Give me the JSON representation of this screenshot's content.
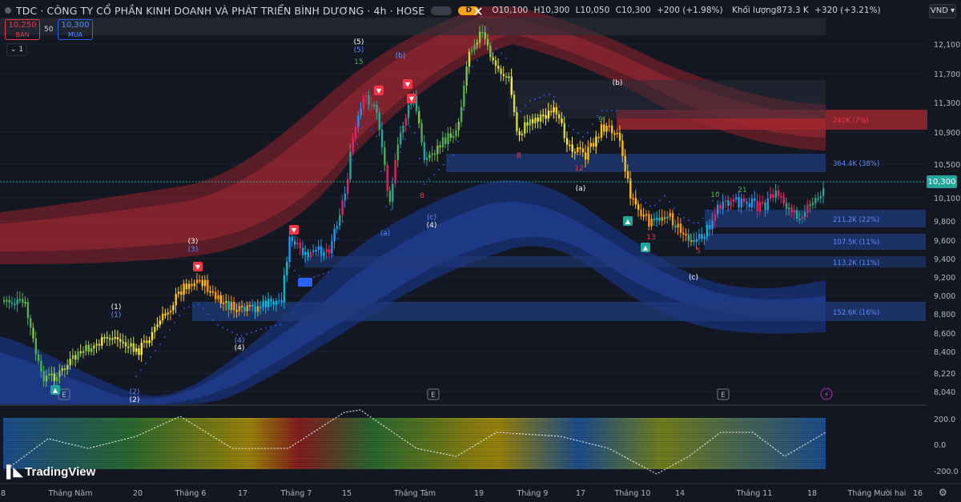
{
  "header": {
    "title": "TDC · CÔNG TY CỔ PHẦN KINH DOANH VÀ PHÁT TRIỂN BÌNH DƯƠNG · 4h · HOSE",
    "badge": "D",
    "ohlc": {
      "open_label": "O",
      "open": "10,100",
      "high_label": "H",
      "high": "10,300",
      "low_label": "L",
      "low": "10,050",
      "close_label": "C",
      "close": "10,300",
      "change": "+200 (+1.98%)",
      "volume_label": "Khối lượng",
      "volume": "873.3 K",
      "volume_change": "+320 (+3.21%)"
    }
  },
  "trade": {
    "bid_price": "10,250",
    "bid_label": "BÁN",
    "spread": "50",
    "ask_price": "10,300",
    "ask_label": "MUA",
    "collapse_label": "1"
  },
  "currency": "VND",
  "brand": "TradingView",
  "price_axis": [
    "12,100",
    "11,700",
    "11,300",
    "10,900",
    "10,500",
    "10,100",
    "9,800",
    "9,600",
    "9,400",
    "9,200",
    "9,000",
    "8,800",
    "8,600",
    "8,400",
    "8,220",
    "8,040"
  ],
  "price_ticks_value": [
    12100,
    11700,
    11300,
    10900,
    10500,
    10100,
    9800,
    9600,
    9400,
    9200,
    9000,
    8800,
    8600,
    8400,
    8220,
    8040
  ],
  "current_price": "10,300",
  "osc_axis": [
    "200.0",
    "0.0",
    "-200.0"
  ],
  "time_axis": [
    "8",
    "Tháng Năm",
    "20",
    "Tháng 6",
    "17",
    "Tháng 7",
    "15",
    "Tháng Tám",
    "19",
    "Tháng 9",
    "17",
    "Tháng 10",
    "14",
    "Tháng 11",
    "18",
    "Tháng Mười hai",
    "16"
  ],
  "zones": [
    {
      "label": "240K (7%)",
      "color": "#f23645"
    },
    {
      "label": "364.4K (38%)",
      "color": "#5b8cff"
    },
    {
      "label": "211.2K (22%)",
      "color": "#5b8cff"
    },
    {
      "label": "107.5K (11%)",
      "color": "#5b8cff"
    },
    {
      "label": "113.2K (11%)",
      "color": "#5b8cff"
    },
    {
      "label": "152.6K (16%)",
      "color": "#5b8cff"
    }
  ],
  "wave_labels": [
    "(5)",
    "(5)",
    "15",
    "(b)",
    "(b)",
    "(3)",
    "(3)",
    "(1)",
    "(1)",
    "(4)",
    "(4)",
    "(2)",
    "(2)",
    "(a)",
    "(a)",
    "(c)",
    "(c)",
    "(4)",
    "13",
    "8",
    "12",
    "9",
    "10",
    "8",
    "5",
    "21"
  ],
  "chart_data": {
    "type": "candlestick",
    "symbol": "TDC",
    "interval": "4h",
    "exchange": "HOSE",
    "y_axis_ticks": [
      12100,
      11700,
      11300,
      10900,
      10500,
      10100,
      9800,
      9600,
      9400,
      9200,
      9000,
      8800,
      8600,
      8400,
      8220,
      8040
    ],
    "last_close": 10300,
    "colors": {
      "up": "#26a69a",
      "down": "#ef5350",
      "bear_band": "#b2242c",
      "bull_band": "#1e3f9e"
    }
  }
}
